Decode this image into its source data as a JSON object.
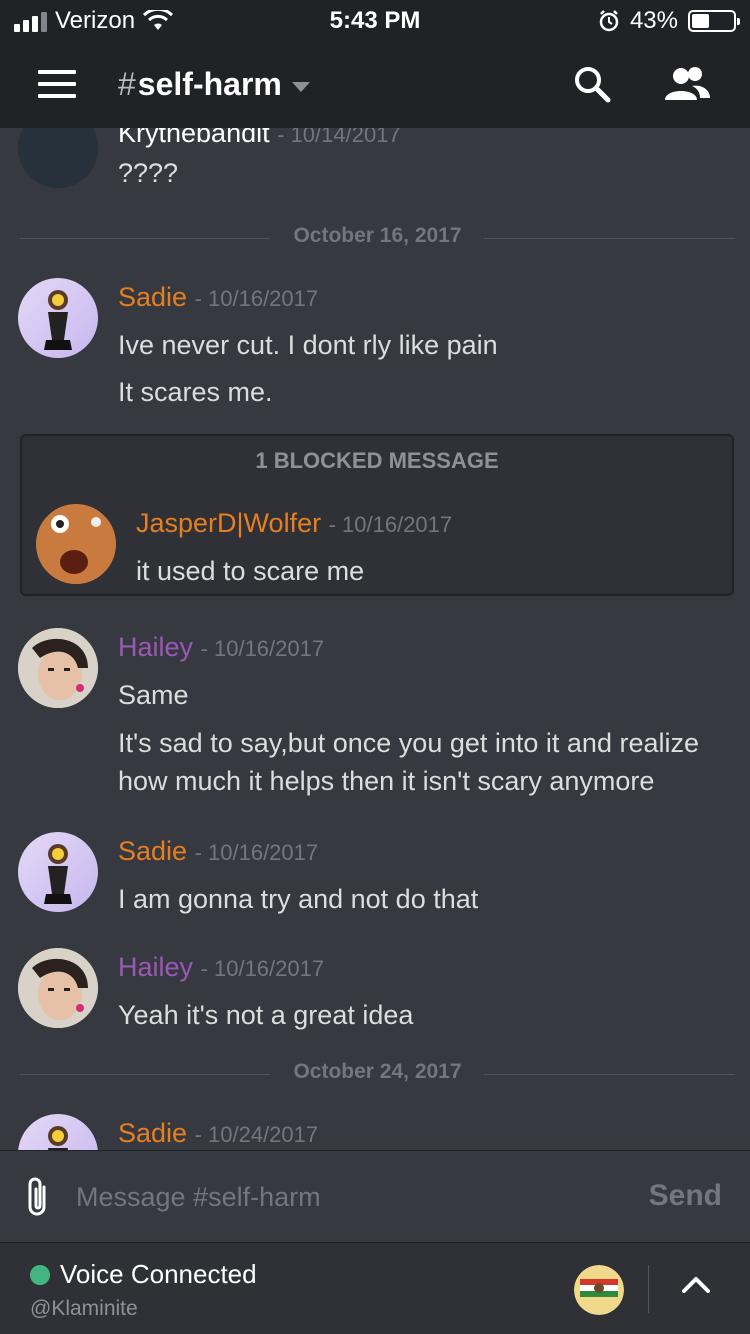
{
  "status_bar": {
    "carrier": "Verizon",
    "time": "5:43 PM",
    "battery": "43%",
    "battery_level": 0.43
  },
  "header": {
    "hash": "#",
    "channel": "self-harm",
    "icons": [
      "menu-icon",
      "chevron-down-icon",
      "search-icon",
      "members-icon"
    ]
  },
  "messages": {
    "top": {
      "username": "Krythebandit",
      "timestamp": "- 10/14/2017",
      "text": "????"
    },
    "divider_1": "October 16, 2017",
    "m1": {
      "username": "Sadie",
      "timestamp": "- 10/16/2017",
      "lines": [
        "Ive never cut. I dont rly like pain",
        "It scares me."
      ]
    },
    "blocked": {
      "title": "1 BLOCKED MESSAGE",
      "username": "JasperD|Wolfer",
      "timestamp": "- 10/16/2017",
      "text": "it used to scare me"
    },
    "m2": {
      "username": "Hailey",
      "timestamp": "- 10/16/2017",
      "lines": [
        "Same",
        "It's sad to say,but once you get into it and realize",
        "how much it helps then it isn't scary anymore"
      ]
    },
    "m3": {
      "username": "Sadie",
      "timestamp": "- 10/16/2017",
      "lines": [
        "I am gonna try and not do that"
      ]
    },
    "m4": {
      "username": "Hailey",
      "timestamp": "- 10/16/2017",
      "lines": [
        "Yeah it's not a great idea"
      ]
    },
    "divider_2": "October 24, 2017",
    "m5": {
      "username": "Sadie",
      "timestamp": "- 10/24/2017"
    }
  },
  "composer": {
    "placeholder": "Message #self-harm",
    "send_label": "Send"
  },
  "voice": {
    "status": "Voice Connected",
    "channel": "@Klaminite"
  },
  "colors": {
    "background": "#36393f",
    "header": "#202225",
    "sadie": "#e67e22",
    "hailey": "#9b59b6",
    "jasper": "#e67e22",
    "voice_dot": "#43b581"
  }
}
